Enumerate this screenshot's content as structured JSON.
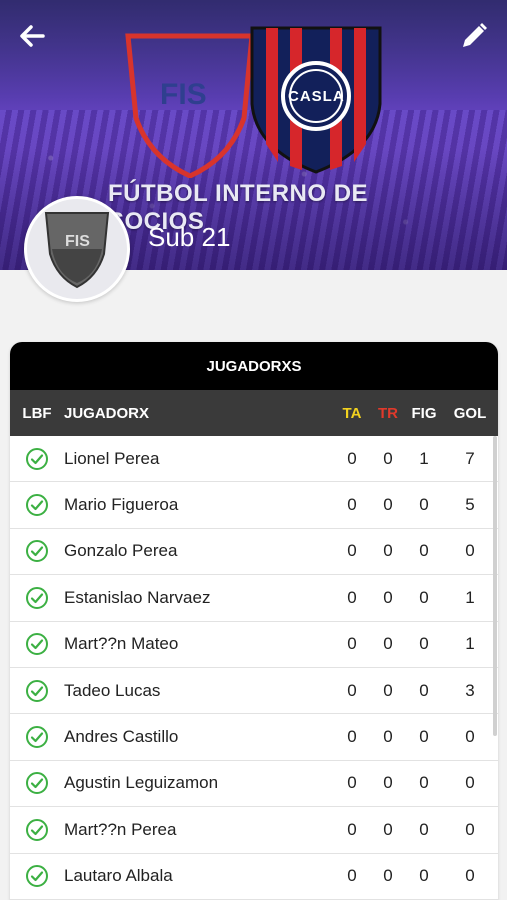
{
  "header": {
    "banner_title": "FÚTBOL INTERNO DE SOCIOS",
    "logo_text": "FIS",
    "club_logo_text": "CASLA",
    "team_name": "Sub 21",
    "avatar_text": "FIS"
  },
  "table": {
    "title": "JUGADORXS",
    "columns": [
      "LBF",
      "JUGADORX",
      "TA",
      "TR",
      "FIG",
      "GOL"
    ],
    "column_colors": {
      "TA": "#f2d21f",
      "TR": "#e0392b"
    },
    "rows": [
      {
        "name": "Lionel Perea",
        "ta": "0",
        "tr": "0",
        "fig": "1",
        "gol": "7"
      },
      {
        "name": "Mario Figueroa",
        "ta": "0",
        "tr": "0",
        "fig": "0",
        "gol": "5"
      },
      {
        "name": "Gonzalo Perea",
        "ta": "0",
        "tr": "0",
        "fig": "0",
        "gol": "0"
      },
      {
        "name": "Estanislao Narvaez",
        "ta": "0",
        "tr": "0",
        "fig": "0",
        "gol": "1"
      },
      {
        "name": "Mart??n Mateo",
        "ta": "0",
        "tr": "0",
        "fig": "0",
        "gol": "1"
      },
      {
        "name": "Tadeo Lucas",
        "ta": "0",
        "tr": "0",
        "fig": "0",
        "gol": "3"
      },
      {
        "name": "Andres Castillo",
        "ta": "0",
        "tr": "0",
        "fig": "0",
        "gol": "0"
      },
      {
        "name": "Agustin Leguizamon",
        "ta": "0",
        "tr": "0",
        "fig": "0",
        "gol": "0"
      },
      {
        "name": "Mart??n Perea",
        "ta": "0",
        "tr": "0",
        "fig": "0",
        "gol": "0"
      },
      {
        "name": "Lautaro Albala",
        "ta": "0",
        "tr": "0",
        "fig": "0",
        "gol": "0"
      }
    ]
  },
  "icons": {
    "back": "arrow-left-icon",
    "edit": "pencil-icon",
    "lbf_status": "check-circle-icon",
    "check_color": "#3cb043"
  }
}
